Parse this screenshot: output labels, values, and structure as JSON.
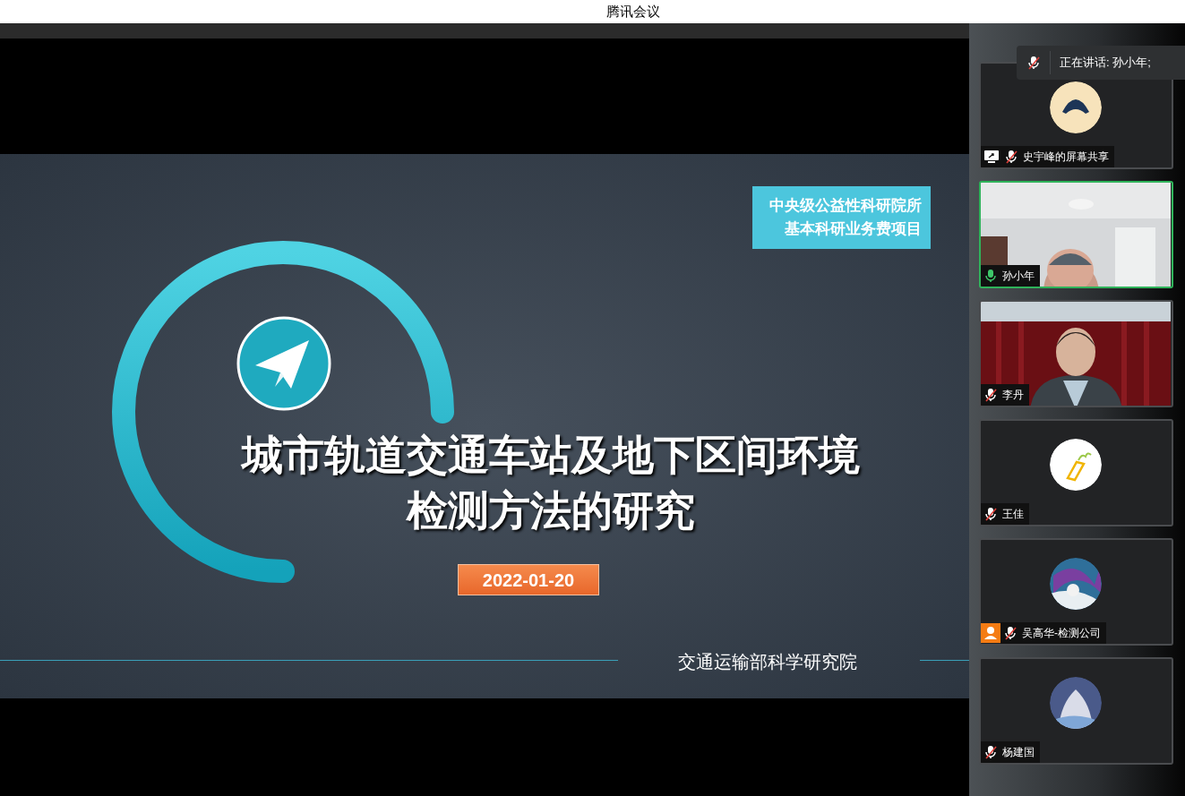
{
  "window": {
    "title": "腾讯会议"
  },
  "speaking_banner": {
    "text": "正在讲话: 孙小年;",
    "muted": true
  },
  "slide": {
    "badge_lines": [
      "中央级公益性科研院所",
      "基本科研业务费项目"
    ],
    "title_lines": [
      "城市轨道交通车站及地下区间环境",
      "检测方法的研究"
    ],
    "date": "2022-01-20",
    "organization": "交通运输部科学研究院"
  },
  "participants": [
    {
      "name": "史宇峰的屏幕共享",
      "kind": "avatar",
      "color": "#f7e3bb",
      "muted": true,
      "speaking": false,
      "sharing": true,
      "host": false
    },
    {
      "name": "孙小年",
      "kind": "video",
      "muted": false,
      "speaking": true,
      "sharing": false,
      "host": false
    },
    {
      "name": "李丹",
      "kind": "video",
      "muted": true,
      "speaking": false,
      "sharing": false,
      "host": false
    },
    {
      "name": "王佳",
      "kind": "avatar",
      "color": "#ffffff",
      "muted": true,
      "speaking": false,
      "sharing": false,
      "host": false
    },
    {
      "name": "吴高华-检测公司",
      "kind": "avatar",
      "color": "#2f6f9a",
      "muted": true,
      "speaking": false,
      "sharing": false,
      "host": true
    },
    {
      "name": "杨建国",
      "kind": "avatar",
      "color": "#4a5a8a",
      "muted": true,
      "speaking": false,
      "sharing": false,
      "host": false
    }
  ]
}
